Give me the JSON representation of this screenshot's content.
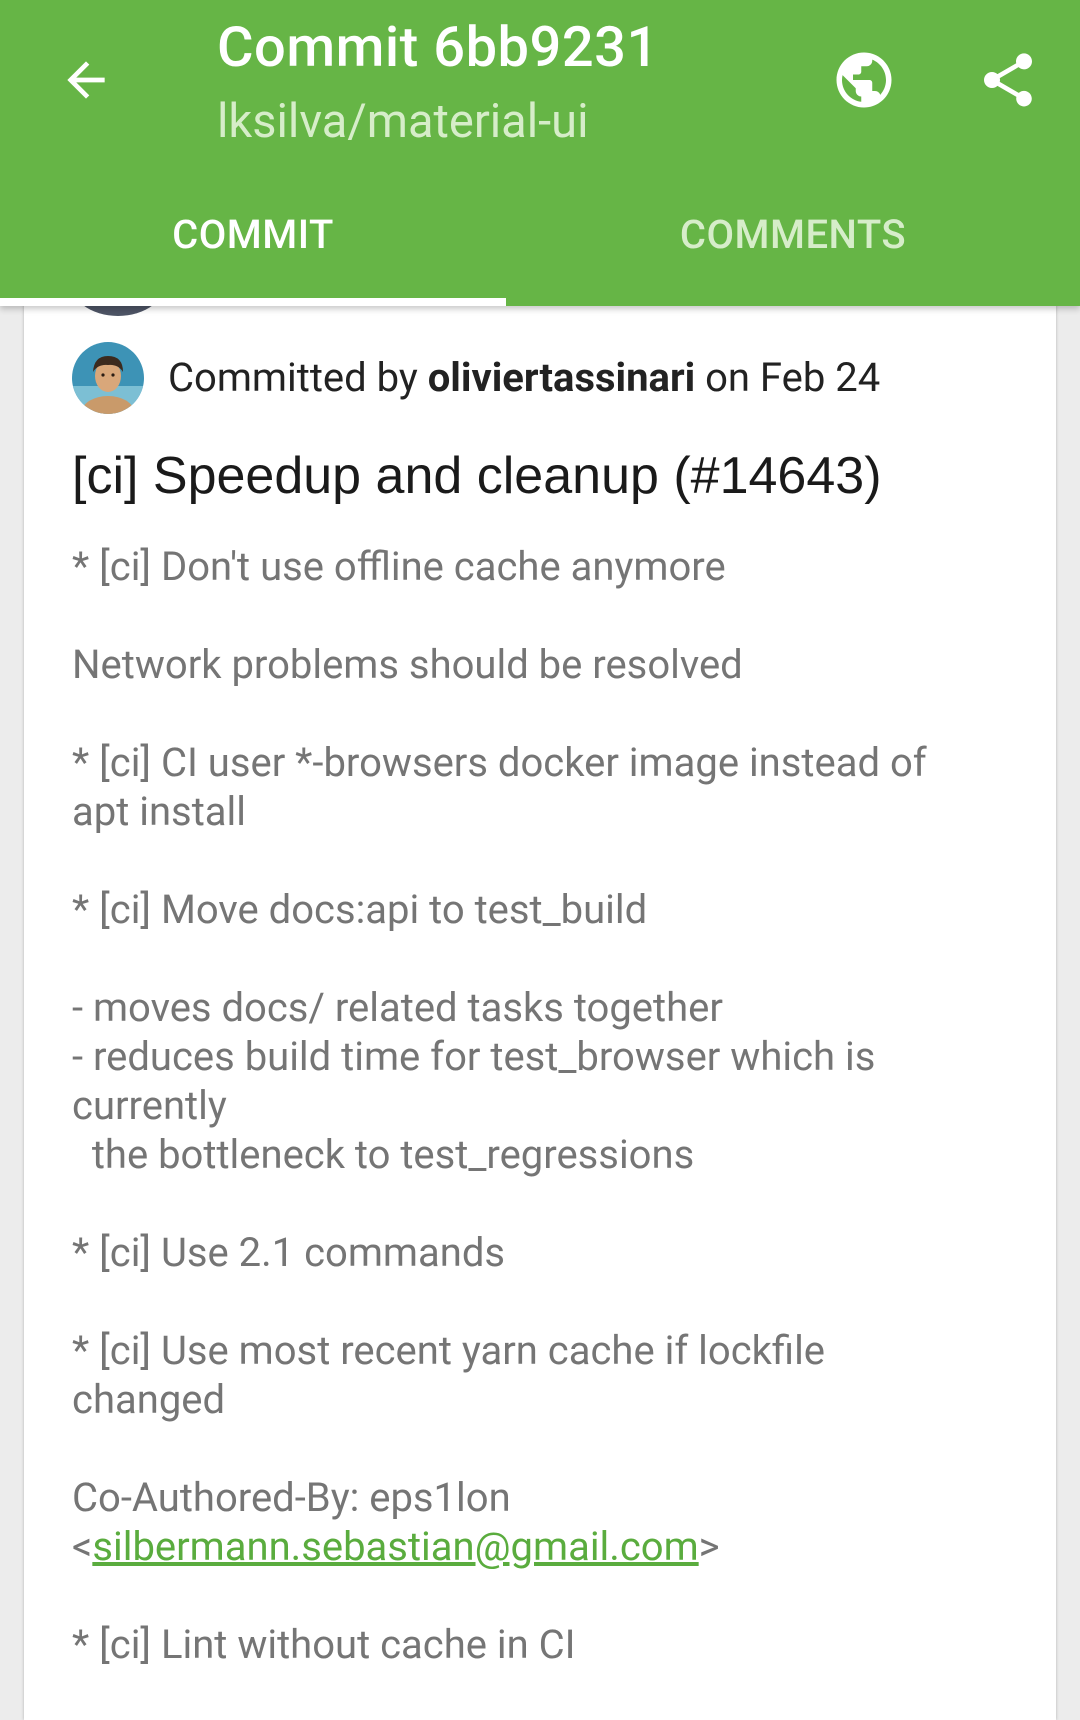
{
  "appbar": {
    "title": "Commit 6bb9231",
    "subtitle": "lksilva/material-ui",
    "icons": {
      "back": "arrow-left-icon",
      "globe": "globe-icon",
      "share": "share-icon"
    },
    "colors": {
      "primary": "#66b546",
      "inactive_text": "#d6edc9"
    }
  },
  "tabs": [
    {
      "label": "COMMIT",
      "selected": true
    },
    {
      "label": "COMMENTS",
      "selected": false
    }
  ],
  "commit": {
    "committed_prefix": "Committed by",
    "author": "oliviertassinari",
    "date_text": "on Feb 24",
    "title": "[ci] Speedup and cleanup (#14643)",
    "message_lines": [
      "* [ci] Don't use offline cache anymore",
      "Network problems should be resolved",
      "* [ci] CI user *-browsers docker image instead of",
      "apt install",
      "* [ci] Move docs:api to test_build",
      "- moves docs/ related tasks together",
      "- reduces build time for test_browser which is",
      "currently",
      "  the bottleneck to test_regressions",
      "* [ci] Use 2.1 commands",
      "* [ci] Use most recent yarn cache if lockfile",
      "changed",
      "Co-Authored-By: eps1lon",
      "* [ci] Lint without cache in CI"
    ],
    "coauthor_email": {
      "open": "<",
      "email": "silbermann.sebastian@gmail.com",
      "close": ">"
    },
    "link_color": "#5aac3e"
  }
}
